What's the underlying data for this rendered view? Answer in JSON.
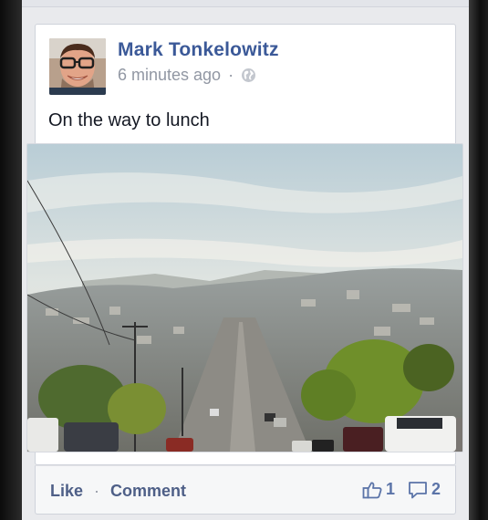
{
  "post": {
    "author": "Mark Tonkelowitz",
    "time": "6 minutes ago",
    "separator": "·",
    "privacy_icon": "globe-icon",
    "text": "On the way to lunch",
    "photo_alt": "city-street-photo"
  },
  "footer": {
    "like_label": "Like",
    "separator": "·",
    "comment_label": "Comment",
    "like_count": "1",
    "comment_count": "2"
  },
  "colors": {
    "name_blue": "#3b5998",
    "meta_gray": "#9197a3",
    "action_blue": "#4e5f87",
    "background": "#e9eaed"
  }
}
